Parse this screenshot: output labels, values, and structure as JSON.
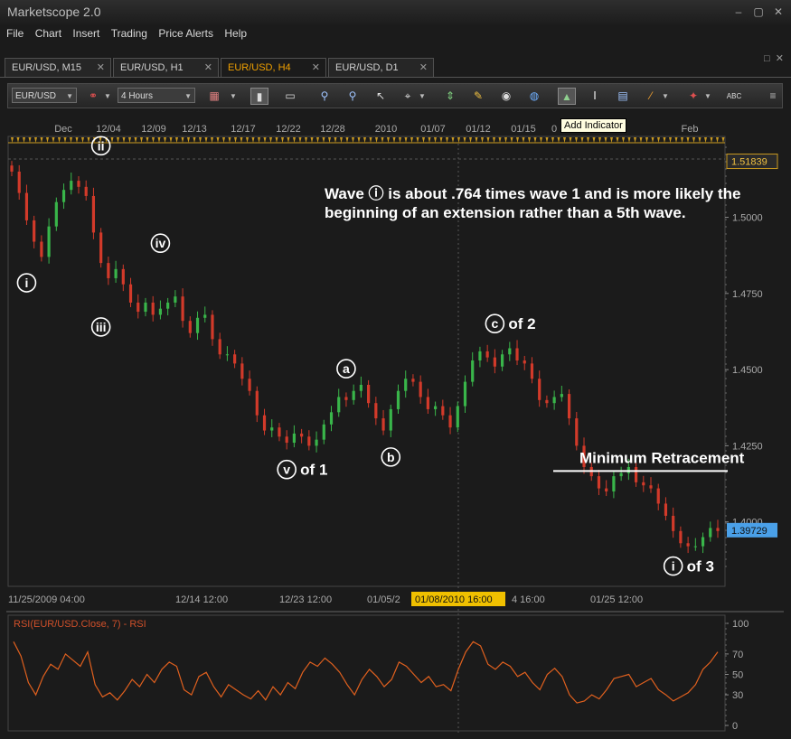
{
  "window": {
    "title": "Marketscope 2.0",
    "minimize": "–",
    "restore": "▢",
    "close": "✕"
  },
  "menu": [
    "File",
    "Chart",
    "Insert",
    "Trading",
    "Price Alerts",
    "Help"
  ],
  "tabs": [
    {
      "label": "EUR/USD, M15",
      "close": "✕"
    },
    {
      "label": "EUR/USD, H1",
      "close": "✕"
    },
    {
      "label": "EUR/USD, H4",
      "close": "✕",
      "active": true
    },
    {
      "label": "EUR/USD, D1",
      "close": "✕"
    }
  ],
  "tab_controls": {
    "restore": "□",
    "close": "✕"
  },
  "toolbar": {
    "instrument": "EUR/USD",
    "timeframe": "4 Hours",
    "tooltip": "Add Indicator",
    "icons": [
      "link-icon",
      "bar-style-icon",
      "candle-mode-icon",
      "line-mode-icon",
      "zoom-in-icon",
      "zoom-out-icon",
      "cursor-icon",
      "crosshair-icon",
      "data-window-icon",
      "notes-icon",
      "eye-icon",
      "globe-icon",
      "add-indicator-icon",
      "text-icon",
      "window-icon",
      "pen-icon",
      "signal-icon",
      "abc-icon"
    ]
  },
  "chart_data": [
    {
      "type": "candlestick",
      "instrument": "EUR/USD",
      "timeframe": "H4",
      "top_date_labels": [
        "Dec",
        "12/04",
        "12/09",
        "12/13",
        "12/17",
        "12/22",
        "12/28",
        "2010",
        "01/07",
        "01/12",
        "01/15",
        "0",
        "Feb"
      ],
      "bottom_date_labels": [
        "11/25/2009 04:00",
        "12/14 12:00",
        "12/23 12:00",
        "01/05/2",
        "4 16:00",
        "01/25 12:00"
      ],
      "crosshair_date": "01/08/2010 16:00",
      "y_ticks": [
        "1.5000",
        "1.4750",
        "1.4500",
        "1.4250",
        "1.4000"
      ],
      "ylim": [
        1.383,
        1.523
      ],
      "price_labels": [
        {
          "text": "1.51839",
          "value": 1.51839
        },
        {
          "text": "1.39729",
          "value": 1.39729
        }
      ],
      "closes": [
        1.515,
        1.508,
        1.499,
        1.492,
        1.487,
        1.497,
        1.505,
        1.509,
        1.512,
        1.51,
        1.507,
        1.495,
        1.485,
        1.48,
        1.483,
        1.478,
        1.472,
        1.469,
        1.472,
        1.468,
        1.47,
        1.472,
        1.474,
        1.466,
        1.462,
        1.467,
        1.468,
        1.46,
        1.455,
        1.455,
        1.452,
        1.447,
        1.443,
        1.435,
        1.43,
        1.431,
        1.428,
        1.426,
        1.429,
        1.428,
        1.425,
        1.427,
        1.432,
        1.436,
        1.441,
        1.44,
        1.443,
        1.445,
        1.439,
        1.434,
        1.43,
        1.437,
        1.443,
        1.447,
        1.446,
        1.441,
        1.437,
        1.438,
        1.435,
        1.431,
        1.438,
        1.446,
        1.453,
        1.456,
        1.454,
        1.451,
        1.455,
        1.457,
        1.453,
        1.452,
        1.447,
        1.44,
        1.439,
        1.441,
        1.442,
        1.434,
        1.425,
        1.418,
        1.415,
        1.411,
        1.41,
        1.415,
        1.416,
        1.418,
        1.413,
        1.412,
        1.411,
        1.406,
        1.402,
        1.397,
        1.393,
        1.392,
        1.392,
        1.395,
        1.398,
        1.397
      ],
      "horizontal_line": {
        "label": "Minimum Retracement",
        "value": 1.4167
      },
      "annotation": "Wave  ⓘ  is about .764 times wave 1 and is more likely the beginning of an extension rather than a 5th wave.",
      "wave_labels": [
        {
          "mark": "i",
          "suffix": "",
          "index": 2,
          "price": 1.4785
        },
        {
          "mark": "ii",
          "suffix": "",
          "index": 12,
          "price": 1.5235
        },
        {
          "mark": "iii",
          "suffix": "",
          "index": 12,
          "price": 1.464
        },
        {
          "mark": "iv",
          "suffix": "",
          "index": 20,
          "price": 1.4915
        },
        {
          "mark": "v",
          "suffix": "of 1",
          "index": 37,
          "price": 1.4172
        },
        {
          "mark": "a",
          "suffix": "",
          "index": 45,
          "price": 1.4503
        },
        {
          "mark": "b",
          "suffix": "",
          "index": 51,
          "price": 1.4213
        },
        {
          "mark": "c",
          "suffix": "of 2",
          "index": 65,
          "price": 1.4651
        },
        {
          "mark": "i",
          "suffix": "of 3",
          "index": 89,
          "price": 1.3855
        }
      ]
    },
    {
      "type": "line",
      "title": "RSI(EUR/USD.Close, 7) - RSI",
      "y_ticks": [
        100,
        70,
        50,
        30,
        0
      ],
      "ylim": [
        0,
        100
      ],
      "values": [
        82,
        68,
        42,
        30,
        48,
        60,
        55,
        70,
        64,
        58,
        72,
        40,
        28,
        32,
        25,
        34,
        45,
        38,
        50,
        42,
        55,
        62,
        58,
        35,
        30,
        48,
        52,
        38,
        28,
        40,
        35,
        30,
        26,
        34,
        25,
        38,
        30,
        42,
        36,
        52,
        62,
        58,
        66,
        60,
        52,
        40,
        30,
        45,
        55,
        48,
        38,
        45,
        62,
        58,
        50,
        42,
        48,
        38,
        40,
        34,
        55,
        72,
        82,
        78,
        60,
        55,
        62,
        58,
        48,
        52,
        42,
        35,
        50,
        56,
        48,
        30,
        22,
        24,
        30,
        26,
        35,
        46,
        48,
        50,
        38,
        42,
        46,
        35,
        30,
        24,
        28,
        32,
        40,
        55,
        62,
        72
      ]
    }
  ]
}
